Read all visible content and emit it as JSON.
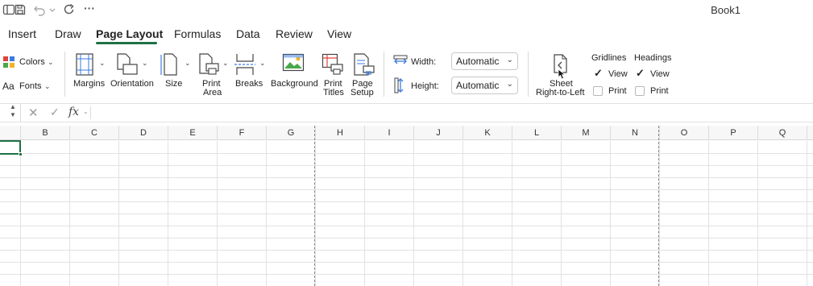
{
  "window": {
    "title": "Book1"
  },
  "quick_access": {
    "icons": [
      "sidebar-icon",
      "save-icon",
      "undo-icon",
      "undo-dropdown-icon",
      "redo-icon",
      "more-icon"
    ],
    "more_label": "···"
  },
  "tabs": [
    {
      "label": "Insert"
    },
    {
      "label": "Draw"
    },
    {
      "label": "Page Layout",
      "active": true
    },
    {
      "label": "Formulas"
    },
    {
      "label": "Data"
    },
    {
      "label": "Review"
    },
    {
      "label": "View"
    }
  ],
  "ribbon": {
    "themes": {
      "colors_label": "Colors",
      "fonts_label": "Fonts"
    },
    "margins": "Margins",
    "orientation": "Orientation",
    "size": "Size",
    "print_area": [
      "Print",
      "Area"
    ],
    "breaks": "Breaks",
    "background": "Background",
    "print_titles": [
      "Print",
      "Titles"
    ],
    "page_setup": [
      "Page",
      "Setup"
    ],
    "width": {
      "label": "Width:",
      "value": "Automatic"
    },
    "height": {
      "label": "Height:",
      "value": "Automatic"
    },
    "sheet_rtl": [
      "Sheet",
      "Right-to-Left"
    ],
    "gridlines": {
      "title": "Gridlines",
      "view_label": "View",
      "view_checked": true,
      "print_label": "Print",
      "print_checked": false
    },
    "headings": {
      "title": "Headings",
      "view_label": "View",
      "view_checked": true,
      "print_label": "Print",
      "print_checked": false
    }
  },
  "formula_bar": {
    "name_box": "",
    "formula": ""
  },
  "grid": {
    "columns": [
      "B",
      "C",
      "D",
      "E",
      "F",
      "G",
      "H",
      "I",
      "J",
      "K",
      "L",
      "M",
      "N",
      "O",
      "P",
      "Q"
    ]
  },
  "colors": {
    "accent": "#1e7145"
  }
}
